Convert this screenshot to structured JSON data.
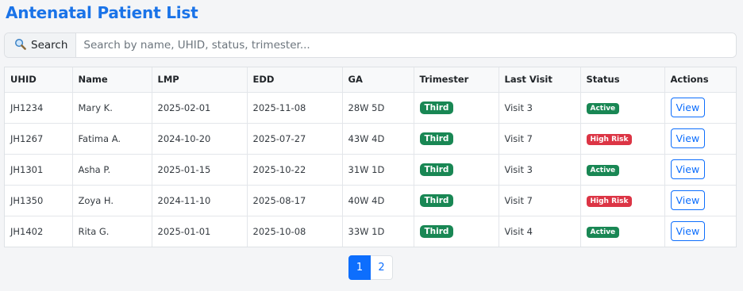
{
  "page": {
    "title": "Antenatal Patient List"
  },
  "search": {
    "icon": "search-icon",
    "label": "Search",
    "placeholder": "Search by name, UHID, status, trimester...",
    "value": ""
  },
  "table": {
    "columns": [
      "UHID",
      "Name",
      "LMP",
      "EDD",
      "GA",
      "Trimester",
      "Last Visit",
      "Status",
      "Actions"
    ],
    "rows": [
      {
        "uhid": "JH1234",
        "name": "Mary K.",
        "lmp": "2025-02-01",
        "edd": "2025-11-08",
        "ga": "28W 5D",
        "trimester": "Third",
        "last_visit": "Visit 3",
        "status": "Active",
        "action": "View"
      },
      {
        "uhid": "JH1267",
        "name": "Fatima A.",
        "lmp": "2024-10-20",
        "edd": "2025-07-27",
        "ga": "43W 4D",
        "trimester": "Third",
        "last_visit": "Visit 7",
        "status": "High Risk",
        "action": "View"
      },
      {
        "uhid": "JH1301",
        "name": "Asha P.",
        "lmp": "2025-01-15",
        "edd": "2025-10-22",
        "ga": "31W 1D",
        "trimester": "Third",
        "last_visit": "Visit 3",
        "status": "Active",
        "action": "View"
      },
      {
        "uhid": "JH1350",
        "name": "Zoya H.",
        "lmp": "2024-11-10",
        "edd": "2025-08-17",
        "ga": "40W 4D",
        "trimester": "Third",
        "last_visit": "Visit 7",
        "status": "High Risk",
        "action": "View"
      },
      {
        "uhid": "JH1402",
        "name": "Rita G.",
        "lmp": "2025-01-01",
        "edd": "2025-10-08",
        "ga": "33W 1D",
        "trimester": "Third",
        "last_visit": "Visit 4",
        "status": "Active",
        "action": "View"
      }
    ]
  },
  "pagination": {
    "pages": [
      "1",
      "2"
    ],
    "current": "1"
  },
  "colors": {
    "title": "#1a73e8",
    "primary": "#0d6efd",
    "success": "#198754",
    "danger": "#dc3545"
  }
}
